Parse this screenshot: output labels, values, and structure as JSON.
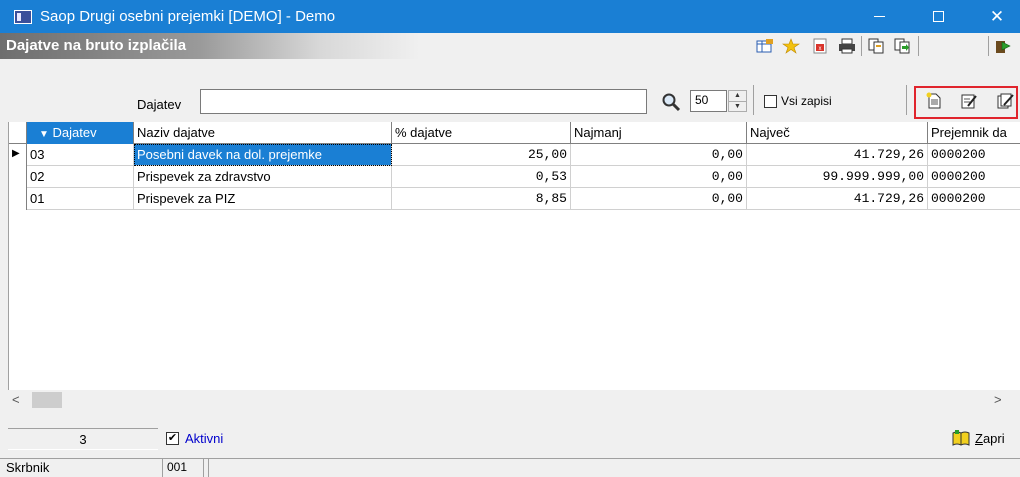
{
  "window": {
    "title": "Saop   Drugi osebni prejemki  [DEMO] - Demo",
    "minimize": "—",
    "maximize": "☐",
    "close": "✕"
  },
  "header": {
    "title": "Dajatve na bruto izplačila",
    "toolbar_icons": [
      "grid-icon",
      "star-icon",
      "export-icon",
      "print-icon",
      "copy-icon",
      "copy-forward-icon",
      "exit-icon"
    ]
  },
  "filter": {
    "label": "Dajatev",
    "value": "",
    "limit": "50",
    "all_records_label": "Vsi zapisi",
    "all_records_checked": false,
    "actions": [
      "new-document-icon",
      "edit-icon",
      "edit-multiple-icon"
    ]
  },
  "table": {
    "columns": [
      "Dajatev",
      "Naziv dajatve",
      "% dajatve",
      "Najmanj",
      "Največ",
      "Prejemnik da"
    ],
    "sort_indicator": "▼",
    "rows": [
      {
        "code": "03",
        "name": "Posebni davek na dol. prejemke",
        "pct": "25,00",
        "min": "0,00",
        "max": "41.729,26",
        "recipient": "0000200",
        "selected": true
      },
      {
        "code": "02",
        "name": "Prispevek za zdravstvo",
        "pct": "0,53",
        "min": "0,00",
        "max": "99.999.999,00",
        "recipient": "0000200",
        "selected": false
      },
      {
        "code": "01",
        "name": "Prispevek za PIZ",
        "pct": "8,85",
        "min": "0,00",
        "max": "41.729,26",
        "recipient": "0000200",
        "selected": false
      }
    ]
  },
  "footer": {
    "count": "3",
    "active_label": "Aktivni",
    "active_checked": true,
    "close_label_ul": "Z",
    "close_label_rest": "apri",
    "skrbnik_label": "Skrbnik",
    "skrbnik_value": "001"
  },
  "scroll": {
    "left_arrow": "<",
    "right_arrow": ">",
    "up_arrow": "▲",
    "down_arrow": "▼"
  }
}
